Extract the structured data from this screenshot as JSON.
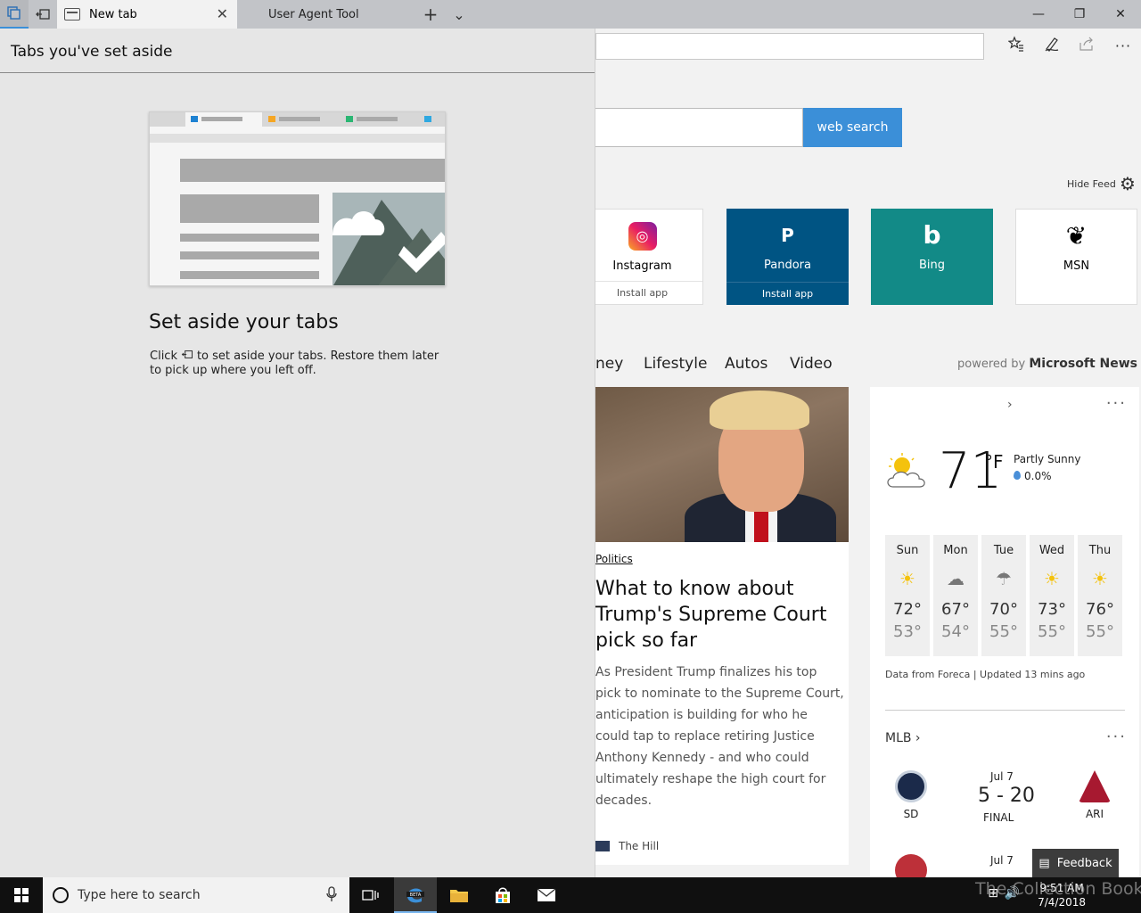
{
  "tabs": {
    "active": {
      "label": "New tab",
      "close": "✕"
    },
    "inactive": {
      "label": "User Agent Tool"
    },
    "new_tab_glyph": "+",
    "tab_list_glyph": "⌄"
  },
  "window_controls": {
    "minimize": "—",
    "restore": "❐",
    "close": "✕"
  },
  "toolbar": {
    "more": "···"
  },
  "search": {
    "button_label": "web search"
  },
  "feed": {
    "hide_label": "Hide Feed"
  },
  "tiles": [
    {
      "name": "Instagram",
      "sub": "Install app",
      "icon": "instagram-icon",
      "glyph": "◎"
    },
    {
      "name": "Pandora",
      "sub": "Install app",
      "icon": "pandora-icon",
      "glyph": "P"
    },
    {
      "name": "Bing",
      "icon": "bing-icon",
      "glyph": "b"
    },
    {
      "name": "MSN",
      "icon": "msn-icon",
      "glyph": "❦"
    }
  ],
  "news_nav": [
    "ney",
    "Lifestyle",
    "Autos",
    "Video"
  ],
  "powered_by": {
    "prefix": "powered by",
    "brand": "Microsoft News"
  },
  "article": {
    "category": "Politics",
    "title": "What to know about Trump's Supreme Court pick so far",
    "description": "As President Trump finalizes his top pick to nominate to the Supreme Court, anticipation is building for who he could tap to replace retiring Justice Anthony Kennedy - and who could ultimately reshape the high court for decades.",
    "source": "The Hill"
  },
  "weather": {
    "temp": "71",
    "unit": "°F",
    "condition": "Partly Sunny",
    "precip": "0.0%",
    "forecast": [
      {
        "day": "Sun",
        "hi": "72°",
        "lo": "53°",
        "icon": "sun-icon"
      },
      {
        "day": "Mon",
        "hi": "67°",
        "lo": "54°",
        "icon": "cloud-icon"
      },
      {
        "day": "Tue",
        "hi": "70°",
        "lo": "55°",
        "icon": "rain-icon"
      },
      {
        "day": "Wed",
        "hi": "73°",
        "lo": "55°",
        "icon": "sun-icon"
      },
      {
        "day": "Thu",
        "hi": "76°",
        "lo": "55°",
        "icon": "sun-icon"
      }
    ],
    "footer": "Data from Foreca | Updated 13 mins ago"
  },
  "mlb": {
    "label": "MLB",
    "game1": {
      "date": "Jul 7",
      "score": "5 - 20",
      "status": "FINAL",
      "home": "SD",
      "away": "ARI"
    },
    "game2": {
      "date": "Jul 7"
    }
  },
  "feedback": {
    "label": "Feedback"
  },
  "set_aside": {
    "panel_title": "Tabs you've set aside",
    "heading": "Set aside your tabs",
    "text_before": "Click",
    "text_after": "to set aside your tabs. Restore them later to pick up where you left off."
  },
  "taskbar": {
    "search_placeholder": "Type here to search",
    "time": "9:51 AM",
    "date": "7/4/2018"
  },
  "watermark": "The Collection Book"
}
